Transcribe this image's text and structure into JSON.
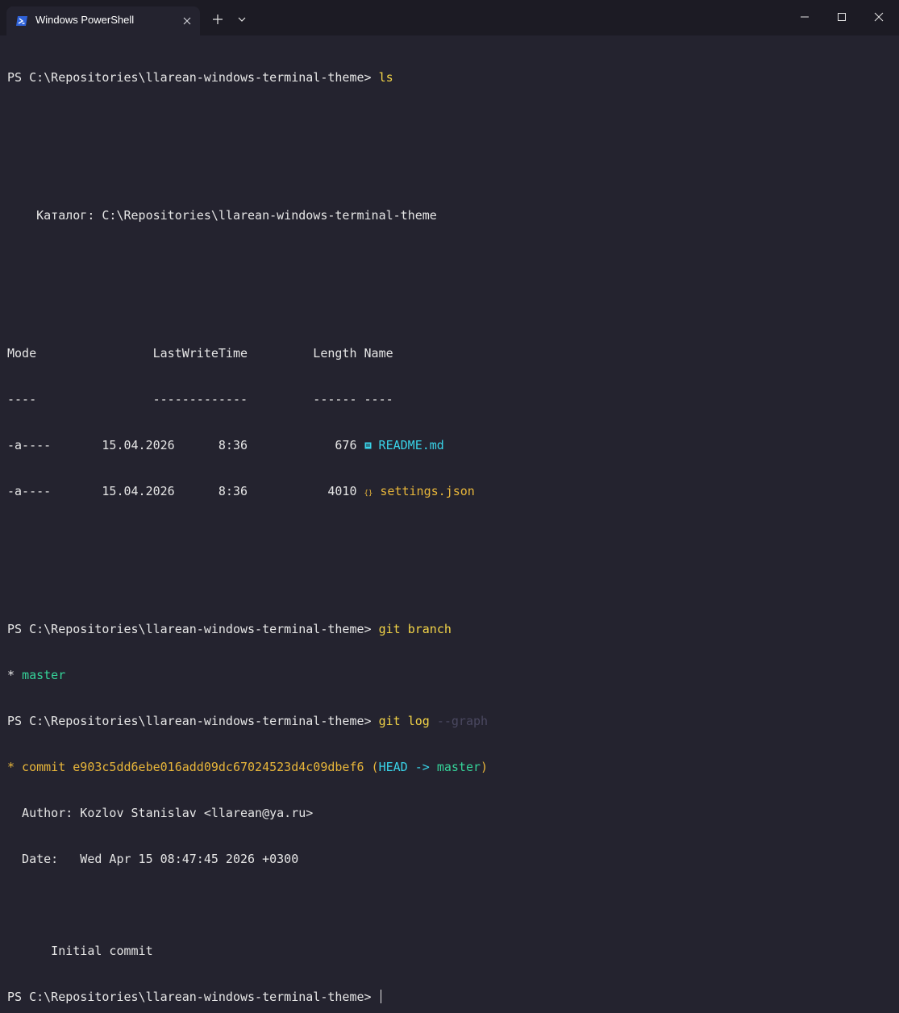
{
  "tab": {
    "title": "Windows PowerShell",
    "icon": "powershell-icon"
  },
  "titlebar": {
    "new_tab_icon": "plus-icon",
    "dropdown_icon": "chevron-down-icon",
    "minimize_icon": "minimize-icon",
    "maximize_icon": "maximize-icon",
    "close_icon": "close-icon"
  },
  "colors": {
    "background": "#24232f",
    "titlebar": "#1c1b24",
    "text": "#e6e6e6",
    "command": "#f3d447",
    "dim": "#4a4860",
    "green": "#35d399",
    "cyan": "#39d3e8",
    "yellow": "#e8b63a"
  },
  "terminal": {
    "prompt": "PS C:\\Repositories\\llarean-windows-terminal-theme> ",
    "cmd1": "ls",
    "directory_line": "    Каталог: C:\\Repositories\\llarean-windows-terminal-theme",
    "header": "Mode                LastWriteTime         Length Name",
    "header_rule": "----                -------------         ------ ----",
    "files": [
      {
        "meta": "-a----       15.04.2026      8:36            676 ",
        "icon": "markdown-file-icon",
        "name": "README.md"
      },
      {
        "meta": "-a----       15.04.2026      8:36           4010 ",
        "icon": "json-file-icon",
        "name": "settings.json"
      }
    ],
    "cmd2": "git branch",
    "branch_marker": "* ",
    "branch_name": "master",
    "cmd3_main": "git log ",
    "cmd3_arg": "--graph",
    "commit_prefix": "* commit e903c5dd6ebe016add09dc67024523d4c09dbef6 ",
    "commit_ref_open": "(",
    "commit_head": "HEAD -> ",
    "commit_branch": "master",
    "commit_ref_close": ")",
    "author_line": "  Author: Kozlov Stanislav <llarean@ya.ru>",
    "date_line": "  Date:   Wed Apr 15 08:47:45 2026 +0300",
    "message_line": "      Initial commit"
  }
}
